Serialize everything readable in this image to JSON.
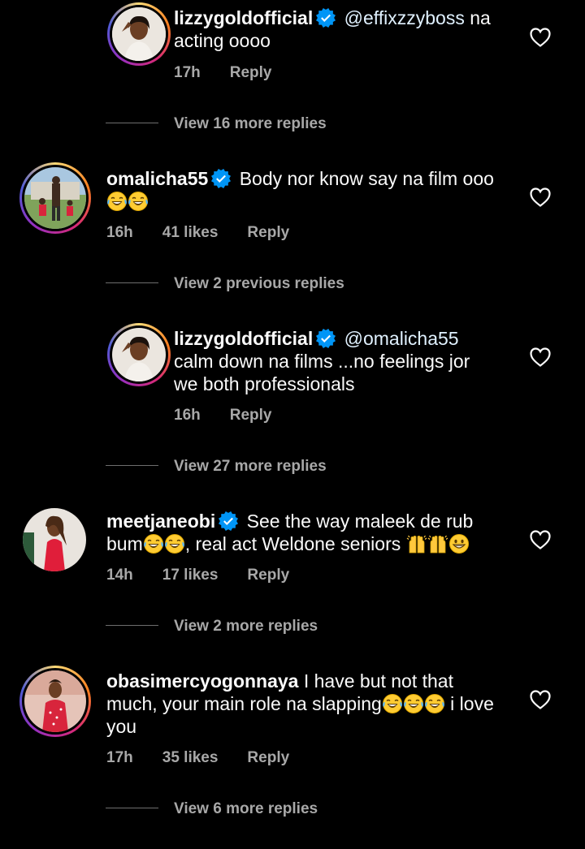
{
  "comments": [
    {
      "username": "lizzygoldofficial",
      "mention": "@effixzzyboss",
      "text": " na acting oooo",
      "time": "17h",
      "likes": "",
      "reply": "Reply"
    },
    {
      "username": "omalicha55",
      "text": "Body nor know say na film ooo",
      "time": "16h",
      "likes": "41 likes",
      "reply": "Reply"
    },
    {
      "username": "lizzygoldofficial",
      "mention": "@omalicha55",
      "text": "calm down na films ...no feelings jor we both professionals",
      "time": "16h",
      "likes": "",
      "reply": "Reply"
    },
    {
      "username": "meetjaneobi",
      "text1": "See the way maleek de rub bum",
      "text2": ", real act Weldone seniors ",
      "time": "14h",
      "likes": "17 likes",
      "reply": "Reply"
    },
    {
      "username": "obasimercyogonnaya",
      "text1": " I have but not that much, your main role na slapping",
      "text2": " i love you",
      "time": "17h",
      "likes": "35 likes",
      "reply": "Reply"
    }
  ],
  "reply_links": [
    "View 16 more replies",
    "View 2 previous replies",
    "View 27 more replies",
    "View 2 more replies",
    "View 6 more replies"
  ],
  "icons": {
    "verified": "verified-badge-icon",
    "heart": "heart-outline-icon",
    "laugh": "tears-of-joy-emoji",
    "hands": "raised-hands-emoji",
    "grin": "grinning-emoji"
  },
  "colors": {
    "background": "#000000",
    "text": "#fafafa",
    "secondary": "#a8a8a8",
    "verified": "#0095f6"
  }
}
